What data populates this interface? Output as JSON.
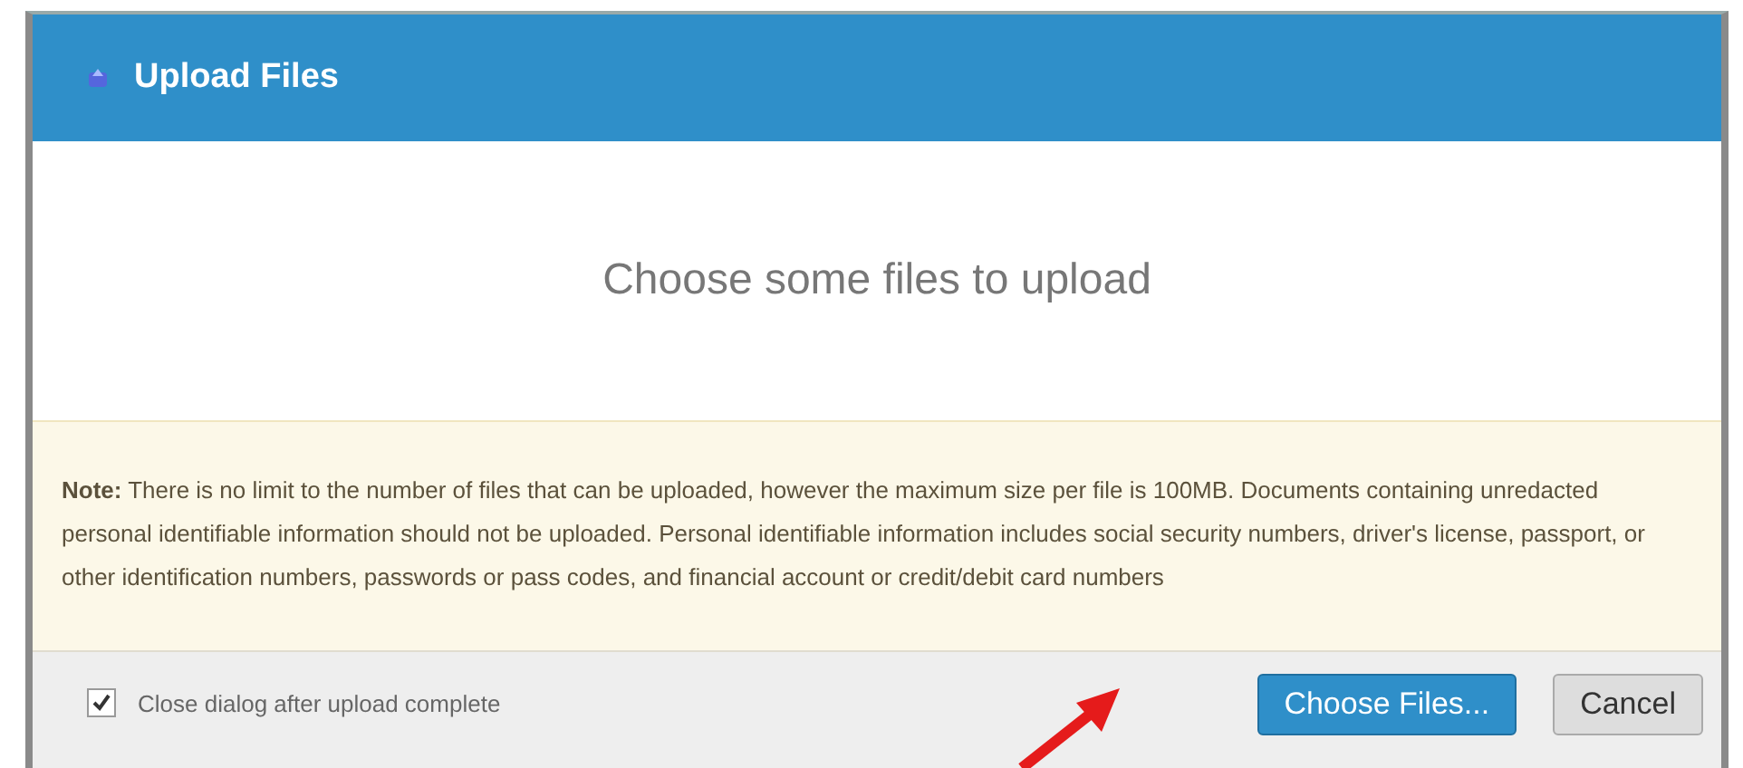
{
  "dialog": {
    "title": "Upload Files",
    "drop_prompt": "Choose some files to upload",
    "note": "**Note:** There is no limit to the number of files that can be uploaded, however the maximum size per file is 100MB. Documents containing unredacted personal identifiable information should not be uploaded. Personal identifiable information includes social security numbers, driver's license, passport, or other identification numbers, passwords or pass codes, and financial account or credit/debit card numbers",
    "close_after_upload": {
      "label": "Close dialog after upload complete",
      "checked": true
    },
    "buttons": [
      {
        "label": "Choose Files...",
        "kind": "primary"
      },
      {
        "label": "Cancel",
        "kind": "default"
      }
    ]
  }
}
